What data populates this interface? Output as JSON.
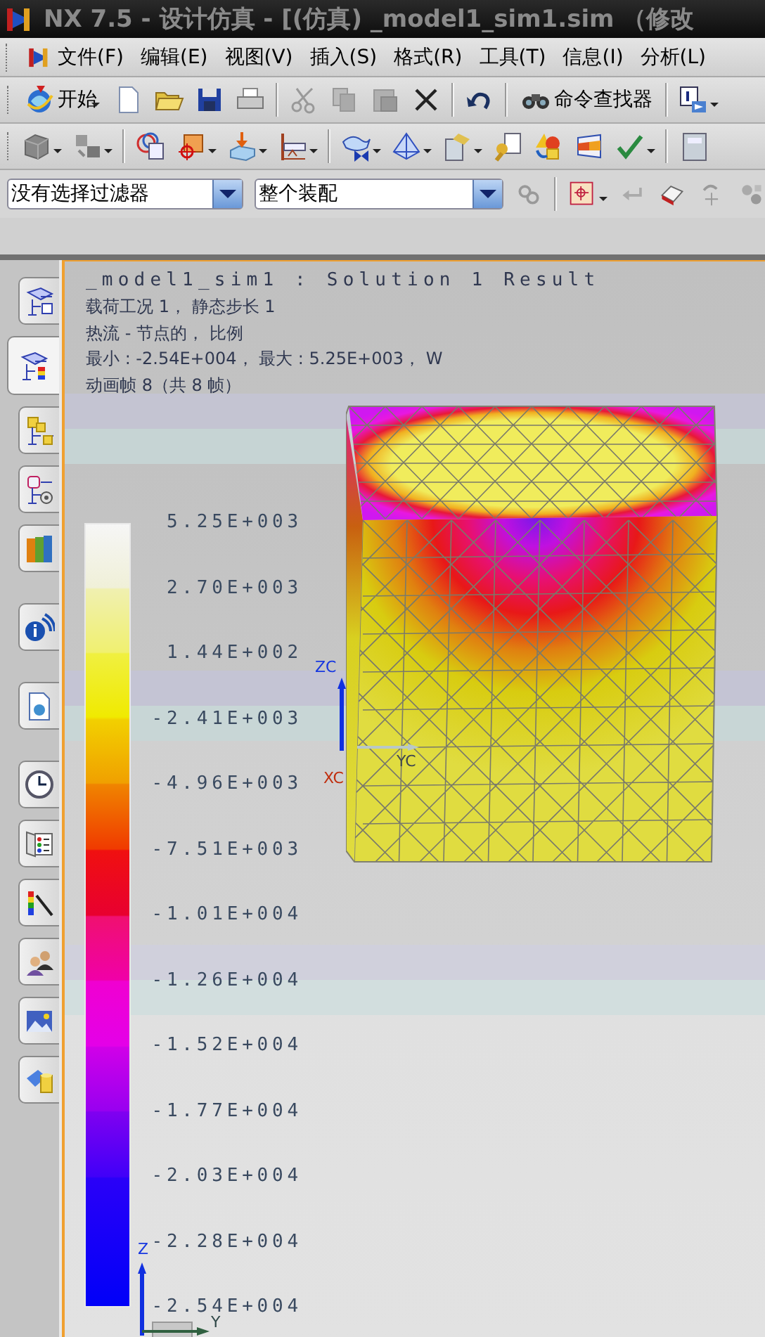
{
  "title_bar": {
    "title": "NX 7.5 - 设计仿真 - [(仿真) _model1_sim1.sim （修改"
  },
  "menu": [
    {
      "label": "文件(F)"
    },
    {
      "label": "编辑(E)"
    },
    {
      "label": "视图(V)"
    },
    {
      "label": "插入(S)"
    },
    {
      "label": "格式(R)"
    },
    {
      "label": "工具(T)"
    },
    {
      "label": "信息(I)"
    },
    {
      "label": "分析(L)"
    }
  ],
  "toolbar": {
    "start": "开始",
    "command_finder": "命令查找器"
  },
  "filters": [
    {
      "value": "没有选择过滤器"
    },
    {
      "value": "整个装配"
    }
  ],
  "resource_tabs": [
    {
      "selected": false
    },
    {
      "selected": true
    },
    {
      "selected": false
    },
    {
      "selected": false
    },
    {
      "selected": false
    },
    {
      "selected": false
    },
    {
      "selected": false
    },
    {
      "selected": false
    },
    {
      "selected": false
    },
    {
      "selected": false
    },
    {
      "selected": false
    },
    {
      "selected": false
    },
    {
      "selected": false
    }
  ],
  "viewport": {
    "result_title": "_model1_sim1 : Solution 1 Result",
    "info_lines": [
      "载荷工况 1， 静态步长 1",
      "热流 - 节点的， 比例",
      "最小 : -2.54E+004， 最大 : 5.25E+003， W",
      "动画帧 8（共 8 帧）"
    ],
    "legend": [
      "5.25E+003",
      "2.70E+003",
      "1.44E+002",
      "-2.41E+003",
      "-4.96E+003",
      "-7.51E+003",
      "-1.01E+004",
      "-1.26E+004",
      "-1.52E+004",
      "-1.77E+004",
      "-2.03E+004",
      "-2.28E+004",
      "-2.54E+004"
    ],
    "model_axes": [
      "ZC",
      "XC",
      "YC"
    ],
    "view_triad": [
      "Z",
      "Y"
    ]
  }
}
